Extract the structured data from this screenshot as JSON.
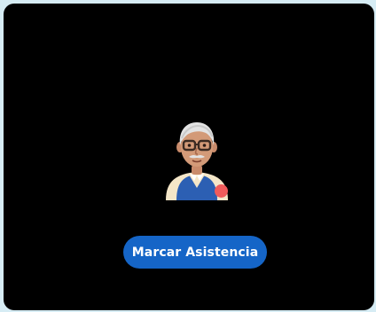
{
  "avatar": {
    "icon": "elderly-man-avatar-icon",
    "status": "offline",
    "status_color": "#f05b5b"
  },
  "attendance_button": {
    "label": "Marcar Asistencia",
    "color": "#1565c7"
  },
  "colors": {
    "background": "#000000",
    "outer": "#d6ecf4"
  }
}
